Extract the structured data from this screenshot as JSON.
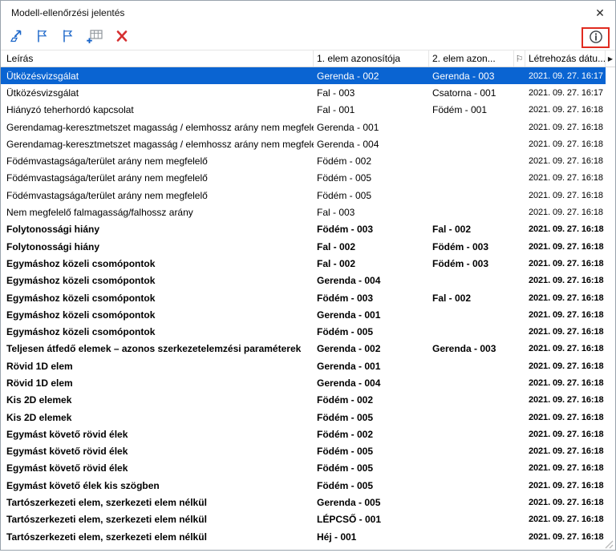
{
  "window": {
    "title": "Modell-ellenőrzési jelentés",
    "close_glyph": "✕"
  },
  "toolbar": {
    "icons": [
      "zoom-to-element-icon",
      "flag-back-icon",
      "flag-forward-icon",
      "table-add-icon",
      "delete-icon",
      "info-icon"
    ],
    "annotation_color": "#e02b20"
  },
  "icons": {
    "flag_column": "⚐",
    "scroll_right": "▶"
  },
  "table": {
    "headers": {
      "desc": "Leírás",
      "e1": "1. elem azonosítója",
      "e2": "2. elem azon...",
      "date": "Létrehozás dátu..."
    },
    "rows": [
      {
        "desc": "Ütközésvizsgálat",
        "e1": "Gerenda - 002",
        "e2": "Gerenda - 003",
        "date": "2021. 09. 27. 16:17",
        "selected": true,
        "bold": false
      },
      {
        "desc": "Ütközésvizsgálat",
        "e1": "Fal - 003",
        "e2": "Csatorna - 001",
        "date": "2021. 09. 27. 16:17",
        "bold": false
      },
      {
        "desc": "Hiányzó teherhordó kapcsolat",
        "e1": "Fal - 001",
        "e2": "Födém - 001",
        "date": "2021. 09. 27. 16:18",
        "bold": false
      },
      {
        "desc": "Gerendamag-keresztmetszet magasság / elemhossz arány nem megfelelő",
        "e1": "Gerenda - 001",
        "e2": "",
        "date": "2021. 09. 27. 16:18",
        "bold": false
      },
      {
        "desc": "Gerendamag-keresztmetszet magasság / elemhossz arány nem megfelelő",
        "e1": "Gerenda - 004",
        "e2": "",
        "date": "2021. 09. 27. 16:18",
        "bold": false
      },
      {
        "desc": "Födémvastagsága/terület arány nem megfelelő",
        "e1": "Födém - 002",
        "e2": "",
        "date": "2021. 09. 27. 16:18",
        "bold": false
      },
      {
        "desc": "Födémvastagsága/terület arány nem megfelelő",
        "e1": "Födém - 005",
        "e2": "",
        "date": "2021. 09. 27. 16:18",
        "bold": false
      },
      {
        "desc": "Födémvastagsága/terület arány nem megfelelő",
        "e1": "Födém - 005",
        "e2": "",
        "date": "2021. 09. 27. 16:18",
        "bold": false
      },
      {
        "desc": "Nem megfelelő falmagasság/falhossz arány",
        "e1": "Fal - 003",
        "e2": "",
        "date": "2021. 09. 27. 16:18",
        "bold": false
      },
      {
        "desc": "Folytonossági hiány",
        "e1": "Födém - 003",
        "e2": "Fal - 002",
        "date": "2021. 09. 27. 16:18",
        "bold": true
      },
      {
        "desc": "Folytonossági hiány",
        "e1": "Fal - 002",
        "e2": "Födém - 003",
        "date": "2021. 09. 27. 16:18",
        "bold": true
      },
      {
        "desc": "Egymáshoz közeli csomópontok",
        "e1": "Fal - 002",
        "e2": "Födém - 003",
        "date": "2021. 09. 27. 16:18",
        "bold": true
      },
      {
        "desc": "Egymáshoz közeli csomópontok",
        "e1": "Gerenda - 004",
        "e2": "",
        "date": "2021. 09. 27. 16:18",
        "bold": true
      },
      {
        "desc": "Egymáshoz közeli csomópontok",
        "e1": "Födém - 003",
        "e2": "Fal - 002",
        "date": "2021. 09. 27. 16:18",
        "bold": true
      },
      {
        "desc": "Egymáshoz közeli csomópontok",
        "e1": "Gerenda - 001",
        "e2": "",
        "date": "2021. 09. 27. 16:18",
        "bold": true
      },
      {
        "desc": "Egymáshoz közeli csomópontok",
        "e1": "Födém - 005",
        "e2": "",
        "date": "2021. 09. 27. 16:18",
        "bold": true
      },
      {
        "desc": "Teljesen átfedő elemek – azonos szerkezetelemzési paraméterek",
        "e1": "Gerenda - 002",
        "e2": "Gerenda - 003",
        "date": "2021. 09. 27. 16:18",
        "bold": true
      },
      {
        "desc": "Rövid 1D elem",
        "e1": "Gerenda - 001",
        "e2": "",
        "date": "2021. 09. 27. 16:18",
        "bold": true
      },
      {
        "desc": "Rövid 1D elem",
        "e1": "Gerenda - 004",
        "e2": "",
        "date": "2021. 09. 27. 16:18",
        "bold": true
      },
      {
        "desc": "Kis 2D elemek",
        "e1": "Födém - 002",
        "e2": "",
        "date": "2021. 09. 27. 16:18",
        "bold": true
      },
      {
        "desc": "Kis 2D elemek",
        "e1": "Födém - 005",
        "e2": "",
        "date": "2021. 09. 27. 16:18",
        "bold": true
      },
      {
        "desc": "Egymást követő rövid élek",
        "e1": "Födém - 002",
        "e2": "",
        "date": "2021. 09. 27. 16:18",
        "bold": true
      },
      {
        "desc": "Egymást követő rövid élek",
        "e1": "Födém - 005",
        "e2": "",
        "date": "2021. 09. 27. 16:18",
        "bold": true
      },
      {
        "desc": "Egymást követő rövid élek",
        "e1": "Födém - 005",
        "e2": "",
        "date": "2021. 09. 27. 16:18",
        "bold": true
      },
      {
        "desc": "Egymást követő élek kis szögben",
        "e1": "Födém - 005",
        "e2": "",
        "date": "2021. 09. 27. 16:18",
        "bold": true
      },
      {
        "desc": "Tartószerkezeti elem, szerkezeti elem nélkül",
        "e1": "Gerenda - 005",
        "e2": "",
        "date": "2021. 09. 27. 16:18",
        "bold": true
      },
      {
        "desc": "Tartószerkezeti elem, szerkezeti elem nélkül",
        "e1": "LÉPCSŐ - 001",
        "e2": "",
        "date": "2021. 09. 27. 16:18",
        "bold": true
      },
      {
        "desc": "Tartószerkezeti elem, szerkezeti elem nélkül",
        "e1": "Héj - 001",
        "e2": "",
        "date": "2021. 09. 27. 16:18",
        "bold": true
      }
    ]
  },
  "colors": {
    "selection": "#0a64d2",
    "toolbar_blue": "#1b66c9",
    "delete_red": "#d63031",
    "annotation_red": "#e02b20"
  }
}
